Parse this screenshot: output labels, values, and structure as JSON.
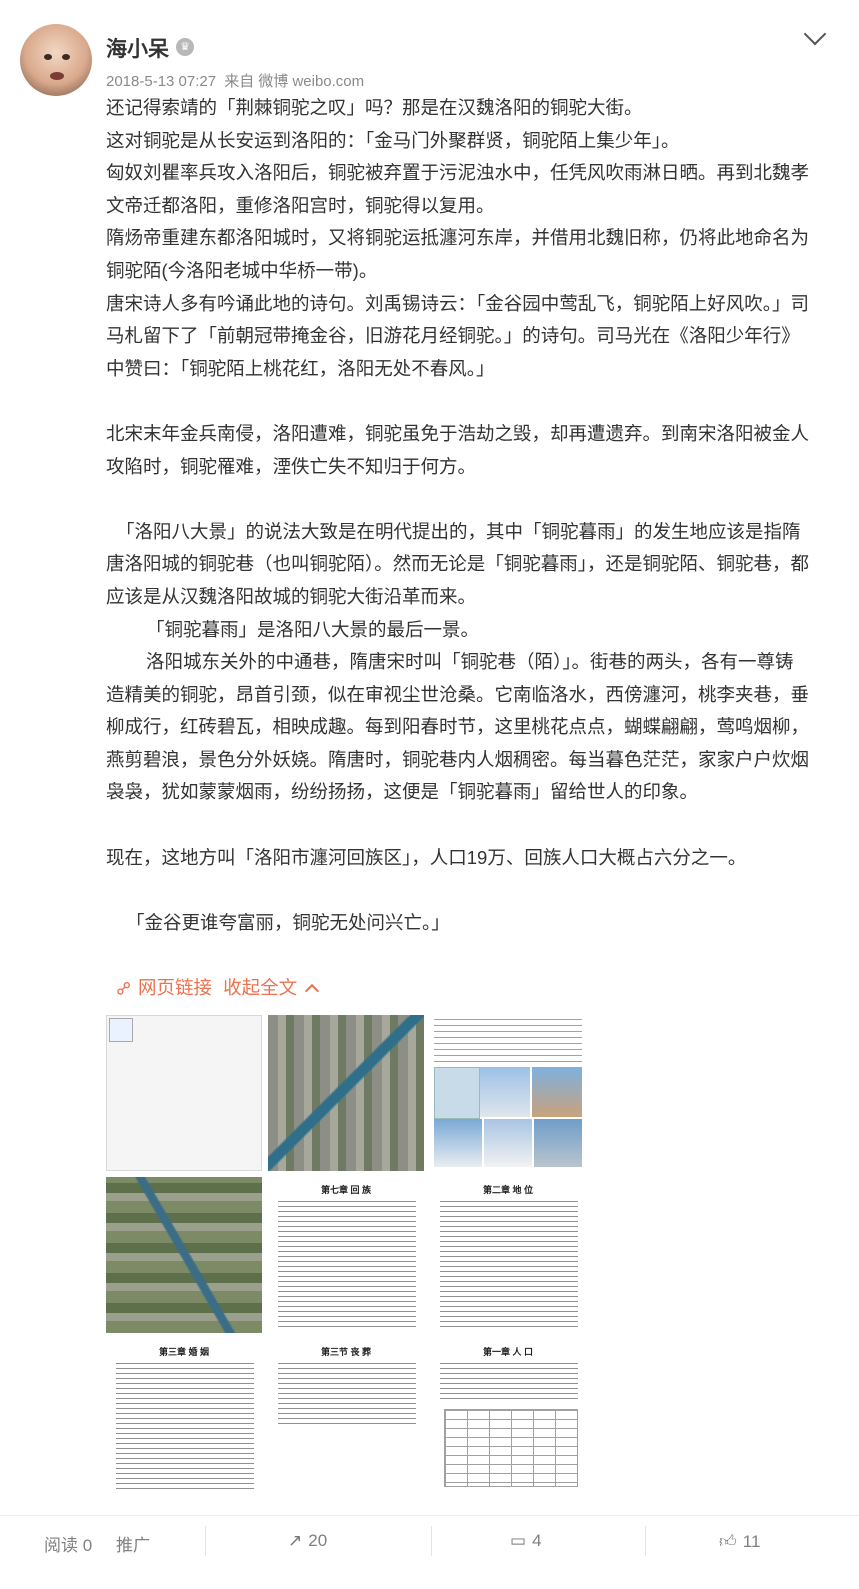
{
  "post": {
    "username": "海小呆",
    "vip_icon": "crown-icon",
    "date": "2018-5-13 07:27",
    "source_prefix": "来自",
    "source": "微博 weibo.com"
  },
  "content": {
    "p1": "还记得索靖的「荆棘铜驼之叹」吗？那是在汉魏洛阳的铜驼大街。",
    "p2": "这对铜驼是从长安运到洛阳的：「金马门外聚群贤，铜驼陌上集少年」。",
    "p3": "匈奴刘瞿率兵攻入洛阳后，铜驼被弃置于污泥浊水中，任凭风吹雨淋日晒。再到北魏孝文帝迁都洛阳，重修洛阳宫时，铜驼得以复用。",
    "p4": "隋炀帝重建东都洛阳城时，又将铜驼运抵瀍河东岸，并借用北魏旧称，仍将此地命名为铜驼陌(今洛阳老城中华桥一带)。",
    "p5": "唐宋诗人多有吟诵此地的诗句。刘禹锡诗云：「金谷园中莺乱飞，铜驼陌上好风吹。」司马札留下了「前朝冠带掩金谷，旧游花月经铜驼。」的诗句。司马光在《洛阳少年行》中赞曰：「铜驼陌上桃花红，洛阳无处不春风。」",
    "p6": "北宋末年金兵南侵，洛阳遭难，铜驼虽免于浩劫之毁，却再遭遗弃。到南宋洛阳被金人攻陷时，铜驼罹难，湮佚亡失不知归于何方。",
    "p7": "「洛阳八大景」的说法大致是在明代提出的，其中「铜驼暮雨」的发生地应该是指隋唐洛阳城的铜驼巷（也叫铜驼陌）。然而无论是「铜驼暮雨」，还是铜驼陌、铜驼巷，都应该是从汉魏洛阳故城的铜驼大街沿革而来。",
    "p8": "「铜驼暮雨」是洛阳八大景的最后一景。",
    "p9": "洛阳城东关外的中通巷，隋唐宋时叫「铜驼巷（陌）」。街巷的两头，各有一尊铸造精美的铜驼，昂首引颈，似在审视尘世沧桑。它南临洛水，西傍瀍河，桃李夹巷，垂柳成行，红砖碧瓦，相映成趣。每到阳春时节，这里桃花点点，蝴蝶翩翩，莺鸣烟柳，燕剪碧浪，景色分外妖娆。隋唐时，铜驼巷内人烟稠密。每当暮色茫茫，家家户户炊烟袅袅，犹如蒙蒙烟雨，纷纷扬扬，这便是「铜驼暮雨」留给世人的印象。",
    "p10": "现在，这地方叫「洛阳市瀍河回族区」，人口19万、回族人口大概占六分之一。",
    "p11": "「金谷更谁夸富丽，铜驼无处问兴亡。」"
  },
  "links": {
    "web_link_label": "网页链接",
    "collapse_label": "收起全文"
  },
  "images": {
    "doc1_title": "第七章  回  族",
    "doc2_title": "第二章  地  位",
    "doc3_title": "第三章  婚  姻",
    "doc4_title": "第三节  丧  葬",
    "doc5_title": "第一章  人  口"
  },
  "footer": {
    "read_label": "阅读",
    "read_count": "0",
    "promote_label": "推广",
    "repost_count": "20",
    "comment_count": "4",
    "like_count": "11"
  },
  "colors": {
    "link": "#eb7350",
    "text": "#333333",
    "meta": "#8a8a8a"
  }
}
